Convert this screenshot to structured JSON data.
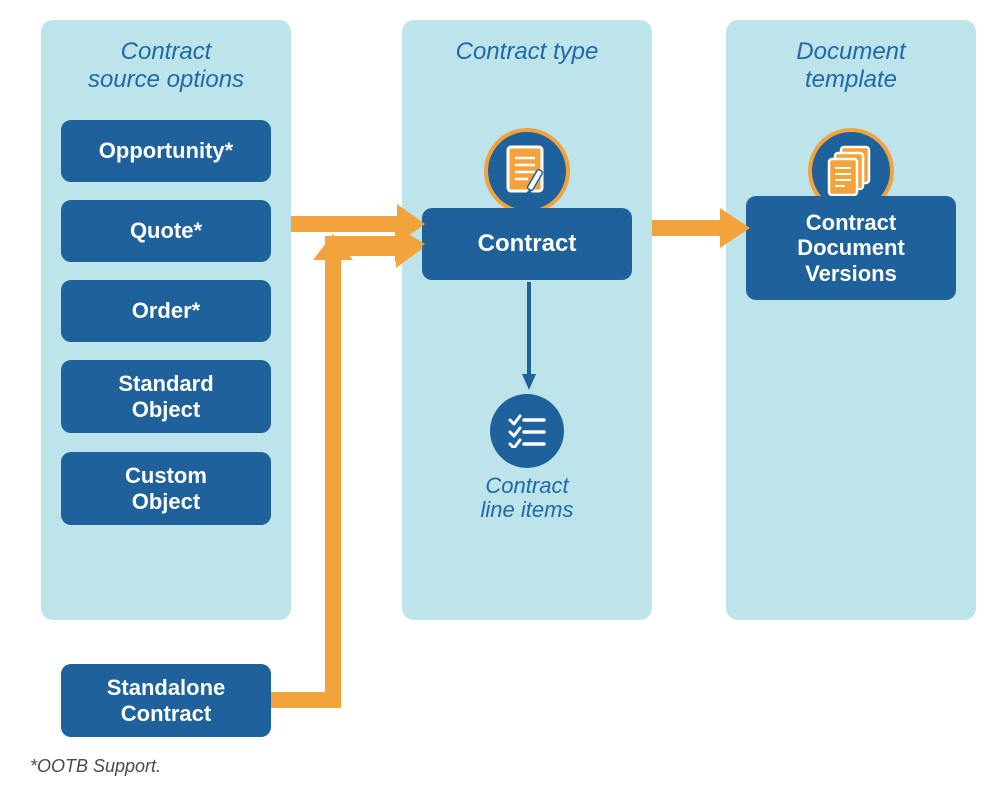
{
  "panels": {
    "source": {
      "title": "Contract\nsource options"
    },
    "type": {
      "title": "Contract type"
    },
    "template": {
      "title": "Document\ntemplate"
    }
  },
  "source_items": [
    {
      "label": "Opportunity*"
    },
    {
      "label": "Quote*"
    },
    {
      "label": "Order*"
    },
    {
      "label": "Standard\nObject"
    },
    {
      "label": "Custom\nObject"
    }
  ],
  "standalone": {
    "label": "Standalone\nContract"
  },
  "contract": {
    "label": "Contract"
  },
  "line_items": {
    "label": "Contract\nline items"
  },
  "doc_versions": {
    "label": "Contract\nDocument\nVersions"
  },
  "footnote": "*OOTB Support.",
  "colors": {
    "panel_bg": "#bde3eb",
    "pill_bg": "#1f619b",
    "accent_orange": "#f2a33c",
    "title_blue": "#1f6aa6"
  }
}
